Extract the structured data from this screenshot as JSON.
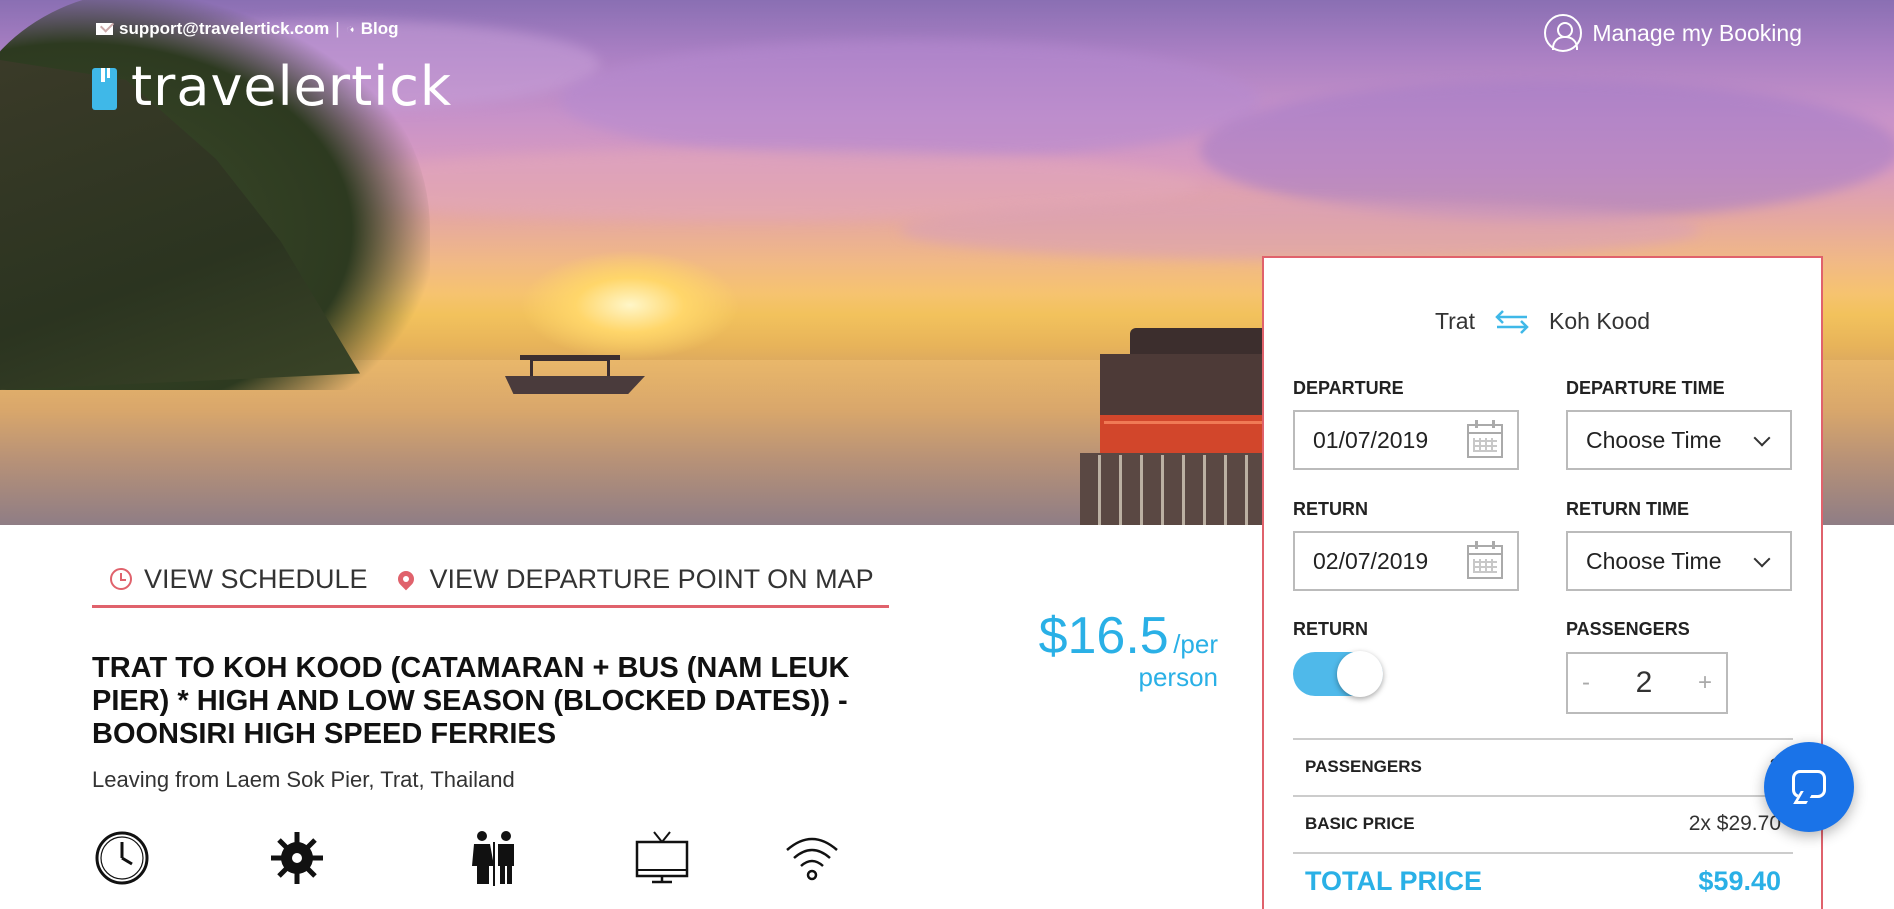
{
  "topbar": {
    "email": "support@travelertick.com",
    "separator": "|",
    "blog": "Blog"
  },
  "logo": {
    "text": "travelertick"
  },
  "header": {
    "manage_booking": "Manage my Booking"
  },
  "tabs": {
    "schedule": "VIEW SCHEDULE",
    "map": "VIEW DEPARTURE POINT ON MAP"
  },
  "trip": {
    "title": "TRAT TO KOH KOOD (CATAMARAN + BUS (NAM LEUK PIER) * HIGH AND LOW SEASON (BLOCKED DATES)) - BOONSIRI HIGH SPEED FERRIES",
    "leaving": "Leaving from Laem Sok Pier, Trat, Thailand",
    "amenities": [
      "clock-icon",
      "air-conditioning-icon",
      "toilet-icon",
      "tv-icon",
      "wifi-icon"
    ]
  },
  "price": {
    "amount": "$16.5",
    "per": "/per",
    "person": "person"
  },
  "booking": {
    "from": "Trat",
    "to": "Koh Kood",
    "departure_label": "DEPARTURE",
    "departure_value": "01/07/2019",
    "departure_time_label": "DEPARTURE TIME",
    "departure_time_value": "Choose Time",
    "return_label": "RETURN",
    "return_value": "02/07/2019",
    "return_time_label": "RETURN TIME",
    "return_time_value": "Choose Time",
    "return_toggle_label": "RETURN",
    "return_toggle_on": true,
    "passengers_label": "PASSENGERS",
    "minus": "-",
    "plus": "+",
    "passengers_value": "2",
    "summary": {
      "passengers_label": "PASSENGERS",
      "passengers_value": "2",
      "basic_label": "BASIC PRICE",
      "basic_value": "2x $29.70",
      "total_label": "TOTAL PRICE",
      "total_value": "$59.40"
    }
  },
  "colors": {
    "accent": "#2ab0e6",
    "border": "#e0626c",
    "brand": "#3fb8e8",
    "chat": "#1a73e8"
  }
}
